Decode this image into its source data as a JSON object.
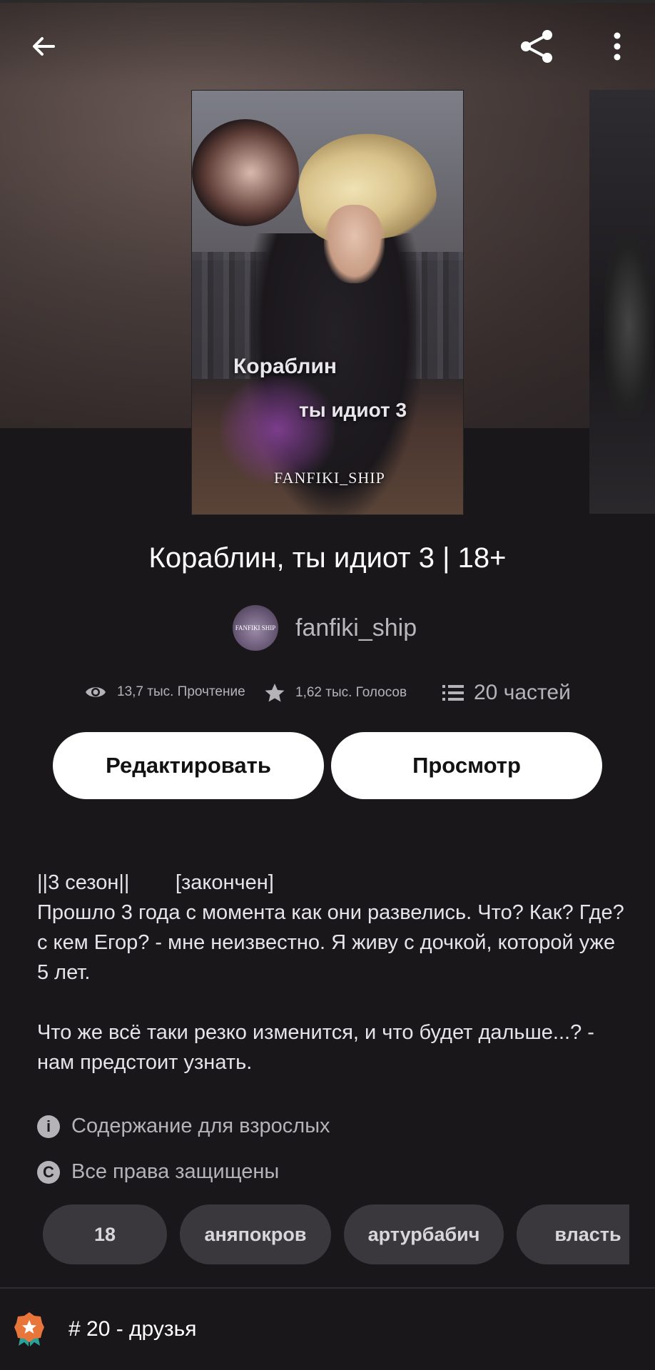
{
  "header": {
    "back_icon": "arrow-left-icon",
    "share_icon": "share-icon",
    "menu_icon": "more-vertical-icon"
  },
  "cover": {
    "title_line1": "Кораблин",
    "title_line2": "ты идиот 3",
    "brand": "FANFIKI_SHIP"
  },
  "story": {
    "title": "Кораблин, ты идиот 3 | 18+",
    "author_name": "fanfiki_ship",
    "avatar_text": "FANFIKI SHIP",
    "reads": "13,7 тыс. Прочтение",
    "votes": "1,62 тыс. Голосов",
    "parts": "20 частей"
  },
  "actions": {
    "edit_label": "Редактировать",
    "preview_label": "Просмотр"
  },
  "description": "||3 сезон||        [закончен]\nПрошло 3 года с момента как они развелись. Что? Как? Где? с кем Егор? - мне неизвестно. Я живу с дочкой, которой уже 5 лет.\n\nЧто же всё таки резко изменится, и что будет дальше...? - нам предстоит узнать.",
  "meta": {
    "mature": "Содержание для взрослых",
    "copyright": "Все права защищены"
  },
  "tags": [
    "18",
    "аняпокров",
    "артурбабич",
    "власть"
  ],
  "ranking": {
    "label": "# 20 - друзья"
  },
  "colors": {
    "background": "#19171a",
    "button_bg": "#ffffff",
    "tag_bg": "#3a383c",
    "badge_orange": "#e8753a",
    "badge_teal": "#2aa198"
  }
}
